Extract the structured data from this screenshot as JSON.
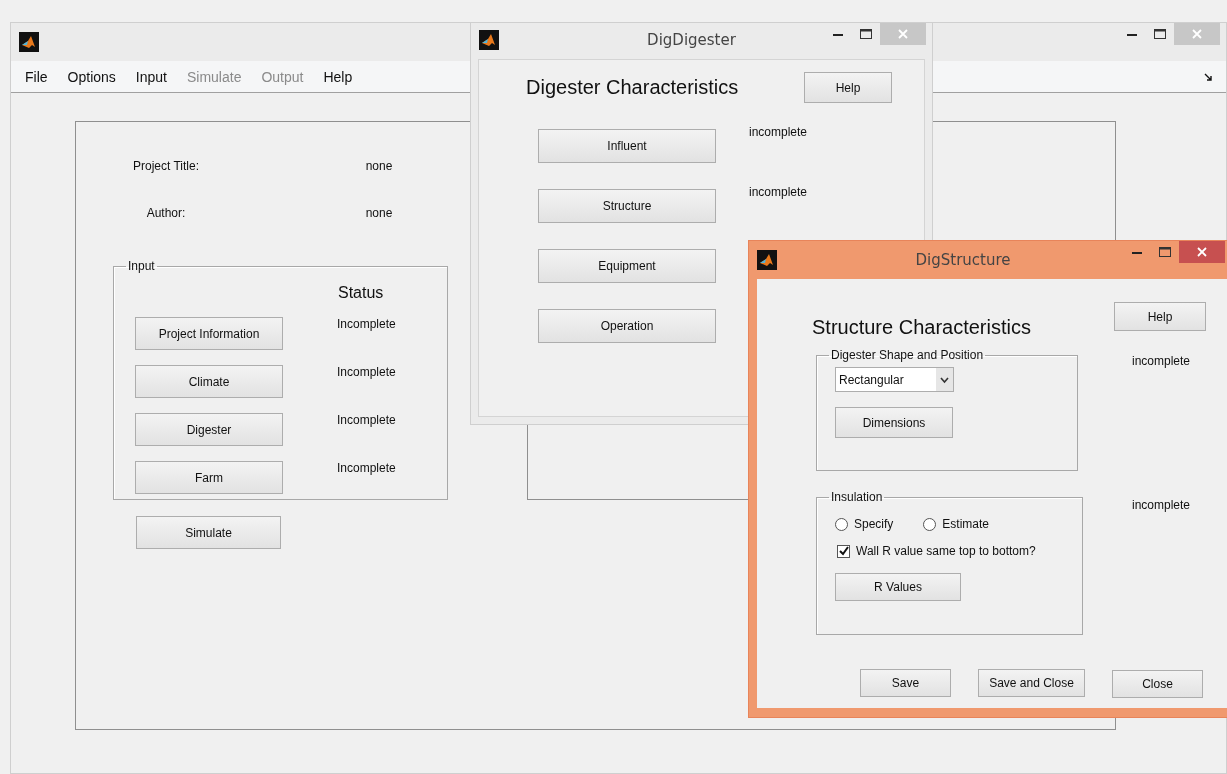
{
  "main_window": {
    "active": false,
    "menu": [
      {
        "label": "File",
        "disabled": false
      },
      {
        "label": "Options",
        "disabled": false
      },
      {
        "label": "Input",
        "disabled": false
      },
      {
        "label": "Simulate",
        "disabled": true
      },
      {
        "label": "Output",
        "disabled": true
      },
      {
        "label": "Help",
        "disabled": false
      }
    ],
    "project_fields": [
      {
        "label": "Project Title:",
        "value": "none"
      },
      {
        "label": "Author:",
        "value": "none"
      }
    ],
    "input_panel": {
      "title": "Input",
      "status_heading": "Status",
      "rows": [
        {
          "button": "Project Information",
          "status": "Incomplete"
        },
        {
          "button": "Climate",
          "status": "Incomplete"
        },
        {
          "button": "Digester",
          "status": "Incomplete"
        },
        {
          "button": "Farm",
          "status": "Incomplete"
        }
      ]
    },
    "simulate_button": "Simulate"
  },
  "digester_window": {
    "title": "DigDigester",
    "active": false,
    "heading": "Digester Characteristics",
    "help_button": "Help",
    "rows": [
      {
        "button": "Influent",
        "status": "incomplete"
      },
      {
        "button": "Structure",
        "status": "incomplete"
      },
      {
        "button": "Equipment"
      },
      {
        "button": "Operation"
      }
    ]
  },
  "structure_window": {
    "title": "DigStructure",
    "active": true,
    "heading": "Structure Characteristics",
    "help_button": "Help",
    "shape_panel": {
      "title": "Digester Shape and Position",
      "dropdown": {
        "value": "Rectangular"
      },
      "button": "Dimensions",
      "status": "incomplete"
    },
    "insulation_panel": {
      "title": "Insulation",
      "radios": [
        {
          "label": "Specify",
          "selected": false
        },
        {
          "label": "Estimate",
          "selected": false
        }
      ],
      "checkbox": {
        "label": "Wall R value same top to bottom?",
        "checked": true
      },
      "button": "R Values",
      "status": "incomplete"
    },
    "buttons": [
      "Save",
      "Save and Close",
      "Close"
    ]
  }
}
